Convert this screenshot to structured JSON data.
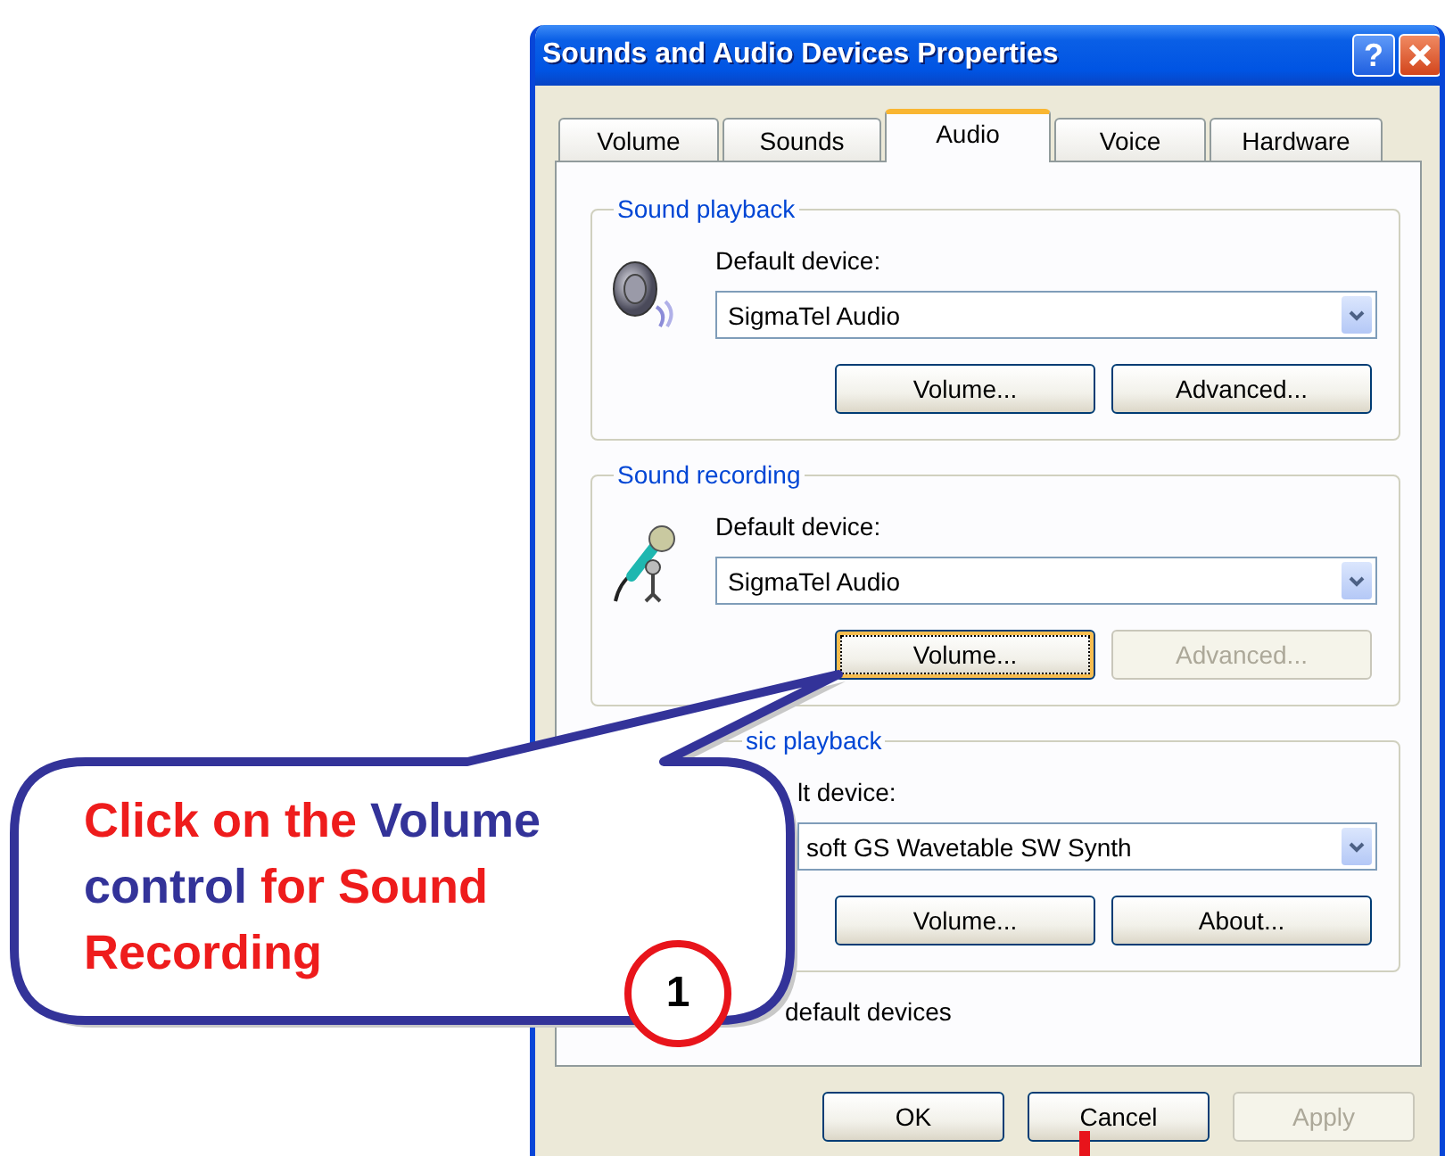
{
  "window": {
    "title": "Sounds and Audio Devices Properties",
    "help_button": "?"
  },
  "tabs": [
    {
      "label": "Volume",
      "selected": false
    },
    {
      "label": "Sounds",
      "selected": false
    },
    {
      "label": "Audio",
      "selected": true
    },
    {
      "label": "Voice",
      "selected": false
    },
    {
      "label": "Hardware",
      "selected": false
    }
  ],
  "groups": [
    {
      "title": "Sound playback",
      "device_label": "Default device:",
      "device": "SigmaTel Audio",
      "buttons": [
        {
          "label": "Volume...",
          "disabled": false,
          "focused": false
        },
        {
          "label": "Advanced...",
          "disabled": false,
          "focused": false
        }
      ]
    },
    {
      "title": "Sound recording",
      "device_label": "Default device:",
      "device": "SigmaTel Audio",
      "buttons": [
        {
          "label": "Volume...",
          "disabled": false,
          "focused": true
        },
        {
          "label": "Advanced...",
          "disabled": true,
          "focused": false
        }
      ]
    },
    {
      "title": "sic playback",
      "device_label": "lt device:",
      "device": "soft GS Wavetable SW Synth",
      "buttons": [
        {
          "label": "Volume...",
          "disabled": false,
          "focused": false
        },
        {
          "label": "About...",
          "disabled": false,
          "focused": false
        }
      ]
    }
  ],
  "option": {
    "label": "default devices"
  },
  "footer_buttons": [
    {
      "label": "OK",
      "disabled": false
    },
    {
      "label": "Cancel",
      "disabled": false
    },
    {
      "label": "Apply",
      "disabled": true
    }
  ],
  "callout": {
    "instruction": [
      {
        "text": "Click on the ",
        "kind": "plain"
      },
      {
        "text": "Volume control",
        "kind": "highlight"
      },
      {
        "text": " for Sound Recording",
        "kind": "plain"
      }
    ],
    "step": "1"
  }
}
